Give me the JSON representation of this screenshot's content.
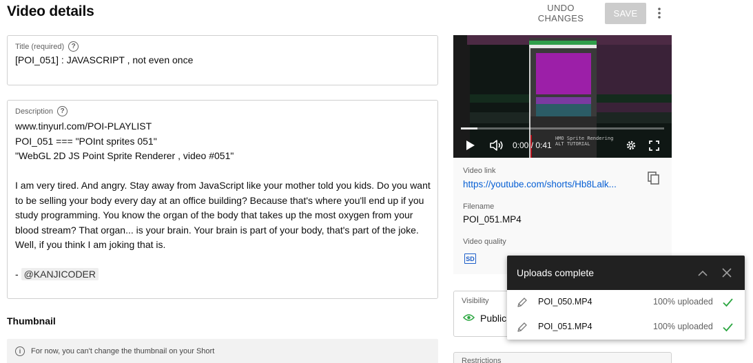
{
  "header": {
    "title": "Video details",
    "undo_label": "UNDO CHANGES",
    "save_label": "SAVE"
  },
  "title_field": {
    "label": "Title (required)",
    "value": "[POI_051] : JAVASCRIPT , not even once"
  },
  "description_field": {
    "label": "Description",
    "lines": [
      "www.tinyurl.com/POI-PLAYLIST",
      "POI_051 === \"POInt sprites 051\"",
      "\"WebGL 2D JS Point Sprite Renderer , video #051\""
    ],
    "paragraph": "I am very tired. And angry. Stay away from JavaScript like your mother told you kids. Do you want to be selling your body every day at an office building? Because that's where you'll end up if you study programming. You know the organ of the body that takes up the most oxygen from your blood stream? That organ... is your brain. Your brain is part of your body, that's part of the joke. Well, if you think I am joking that is.",
    "signature_prefix": "- ",
    "signature_mention": "@KANJICODER"
  },
  "thumbnail": {
    "heading": "Thumbnail",
    "note": "For now, you can't change the thumbnail on your Short"
  },
  "video": {
    "time": "0:00 / 0:41",
    "progress": 0.08,
    "caption_line1": "HMO Sprite Rendering",
    "caption_line2": "ALT TUTORIAL",
    "link_label": "Video link",
    "link_url": "https://youtube.com/shorts/Hb8Lalk...",
    "filename_label": "Filename",
    "filename": "POI_051.MP4",
    "quality_label": "Video quality",
    "quality_badge": "SD"
  },
  "visibility": {
    "label": "Visibility",
    "value": "Public"
  },
  "restrictions": {
    "label": "Restrictions"
  },
  "uploads_toast": {
    "title": "Uploads complete",
    "rows": [
      {
        "file": "POI_050.MP4",
        "status": "100% uploaded"
      },
      {
        "file": "POI_051.MP4",
        "status": "100% uploaded"
      }
    ]
  },
  "colors": {
    "link": "#065fd4",
    "success": "#2ba640",
    "toast_header": "#212121",
    "save_disabled": "#cccccc"
  },
  "icons": [
    "help-icon",
    "more-vert-icon",
    "info-icon",
    "play-icon",
    "volume-icon",
    "settings-icon",
    "fullscreen-icon",
    "copy-icon",
    "eye-icon",
    "chevron-up-icon",
    "close-icon",
    "pencil-icon",
    "check-icon"
  ]
}
